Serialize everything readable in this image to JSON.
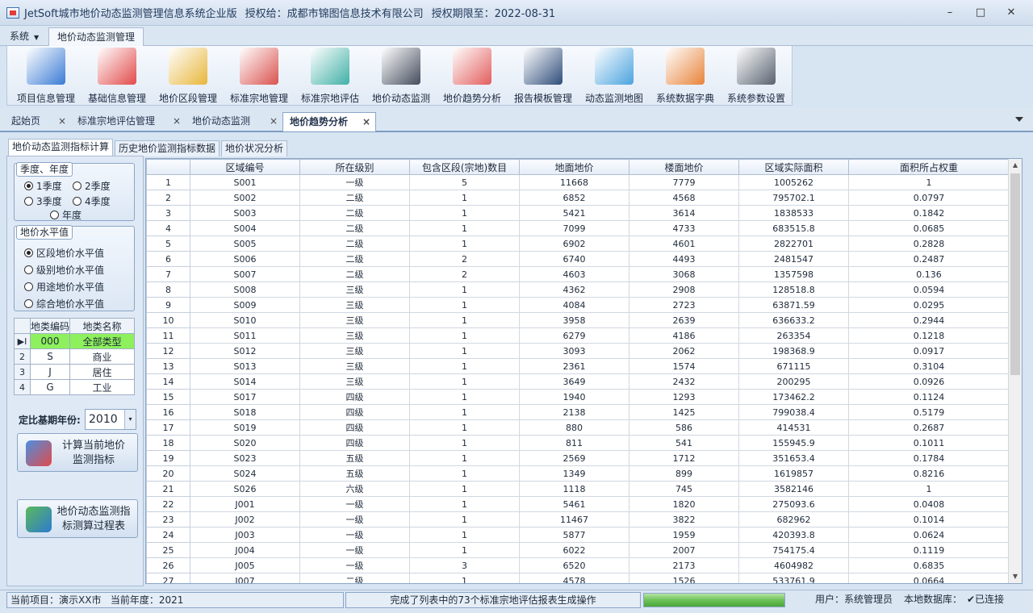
{
  "window": {
    "title_app": "JetSoft城市地价动态监测管理信息系统企业版",
    "title_license": "授权给：成都市锦图信息技术有限公司",
    "title_expiry": "授权期限至：2022-08-31",
    "minimize": "–",
    "maximize": "□",
    "close": "✕"
  },
  "menu": {
    "system": "系统",
    "ribbon_tab": "地价动态监测管理"
  },
  "ribbon": [
    {
      "label": "项目信息管理",
      "icon": "globe-computer-icon",
      "color": "#3a7bd5"
    },
    {
      "label": "基础信息管理",
      "icon": "clipboard-pencil-icon",
      "color": "#e24a4a"
    },
    {
      "label": "地价区段管理",
      "icon": "map-magnifier-icon",
      "color": "#e8b63a"
    },
    {
      "label": "标准宗地管理",
      "icon": "map-pin-icon",
      "color": "#d9534f"
    },
    {
      "label": "标准宗地评估",
      "icon": "house-dollar-icon",
      "color": "#40b0a6"
    },
    {
      "label": "地价动态监测",
      "icon": "monitor-chart-icon",
      "color": "#444c5c"
    },
    {
      "label": "地价趋势分析",
      "icon": "trend-report-icon",
      "color": "#e35d5d"
    },
    {
      "label": "报告模板管理",
      "icon": "laptop-gear-icon",
      "color": "#2f4d7a"
    },
    {
      "label": "动态监测地图",
      "icon": "map-search-icon",
      "color": "#4aa3df"
    },
    {
      "label": "系统数据字典",
      "icon": "bookshelf-icon",
      "color": "#e8833a"
    },
    {
      "label": "系统参数设置",
      "icon": "gears-icon",
      "color": "#596270"
    }
  ],
  "doc_tabs": [
    {
      "label": "起始页",
      "close": "×"
    },
    {
      "label": "标准宗地评估管理",
      "close": "×"
    },
    {
      "label": "地价动态监测",
      "close": "×"
    },
    {
      "label": "地价趋势分析",
      "close": "×"
    }
  ],
  "sub_tabs": [
    "地价动态监测指标计算",
    "历史地价监测指标数据",
    "地价状况分析"
  ],
  "left": {
    "season_group": "季度、年度",
    "q1": "1季度",
    "q2": "2季度",
    "q3": "3季度",
    "q4": "4季度",
    "year": "年度",
    "level_group": "地价水平值",
    "lv1": "区段地价水平值",
    "lv2": "级别地价水平值",
    "lv3": "用途地价水平值",
    "lv4": "综合地价水平值",
    "type_headers": [
      "地类编码",
      "地类名称"
    ],
    "types": [
      {
        "rh": "▶I",
        "code": "000",
        "name": "全部类型"
      },
      {
        "rh": "2",
        "code": "S",
        "name": "商业"
      },
      {
        "rh": "3",
        "code": "J",
        "name": "居住"
      },
      {
        "rh": "4",
        "code": "G",
        "name": "工业"
      }
    ],
    "base_year_label": "定比基期年份:",
    "base_year": "2010",
    "arrow": "▾",
    "calc_line1": "计算当前地价",
    "calc_line2": "监测指标",
    "proc_line1": "地价动态监测指",
    "proc_line2": "标测算过程表"
  },
  "grid": {
    "headers": [
      "区域编号",
      "所在级别",
      "包含区段(宗地)数目",
      "地面地价",
      "楼面地价",
      "区域实际面积",
      "面积所占权重"
    ],
    "rows": [
      [
        "1",
        "S001",
        "一级",
        "5",
        "11668",
        "7779",
        "1005262",
        "1"
      ],
      [
        "2",
        "S002",
        "二级",
        "1",
        "6852",
        "4568",
        "795702.1",
        "0.0797"
      ],
      [
        "3",
        "S003",
        "二级",
        "1",
        "5421",
        "3614",
        "1838533",
        "0.1842"
      ],
      [
        "4",
        "S004",
        "二级",
        "1",
        "7099",
        "4733",
        "683515.8",
        "0.0685"
      ],
      [
        "5",
        "S005",
        "二级",
        "1",
        "6902",
        "4601",
        "2822701",
        "0.2828"
      ],
      [
        "6",
        "S006",
        "二级",
        "2",
        "6740",
        "4493",
        "2481547",
        "0.2487"
      ],
      [
        "7",
        "S007",
        "二级",
        "2",
        "4603",
        "3068",
        "1357598",
        "0.136"
      ],
      [
        "8",
        "S008",
        "三级",
        "1",
        "4362",
        "2908",
        "128518.8",
        "0.0594"
      ],
      [
        "9",
        "S009",
        "三级",
        "1",
        "4084",
        "2723",
        "63871.59",
        "0.0295"
      ],
      [
        "10",
        "S010",
        "三级",
        "1",
        "3958",
        "2639",
        "636633.2",
        "0.2944"
      ],
      [
        "11",
        "S011",
        "三级",
        "1",
        "6279",
        "4186",
        "263354",
        "0.1218"
      ],
      [
        "12",
        "S012",
        "三级",
        "1",
        "3093",
        "2062",
        "198368.9",
        "0.0917"
      ],
      [
        "13",
        "S013",
        "三级",
        "1",
        "2361",
        "1574",
        "671115",
        "0.3104"
      ],
      [
        "14",
        "S014",
        "三级",
        "1",
        "3649",
        "2432",
        "200295",
        "0.0926"
      ],
      [
        "15",
        "S017",
        "四级",
        "1",
        "1940",
        "1293",
        "173462.2",
        "0.1124"
      ],
      [
        "16",
        "S018",
        "四级",
        "1",
        "2138",
        "1425",
        "799038.4",
        "0.5179"
      ],
      [
        "17",
        "S019",
        "四级",
        "1",
        "880",
        "586",
        "414531",
        "0.2687"
      ],
      [
        "18",
        "S020",
        "四级",
        "1",
        "811",
        "541",
        "155945.9",
        "0.1011"
      ],
      [
        "19",
        "S023",
        "五级",
        "1",
        "2569",
        "1712",
        "351653.4",
        "0.1784"
      ],
      [
        "20",
        "S024",
        "五级",
        "1",
        "1349",
        "899",
        "1619857",
        "0.8216"
      ],
      [
        "21",
        "S026",
        "六级",
        "1",
        "1118",
        "745",
        "3582146",
        "1"
      ],
      [
        "22",
        "J001",
        "一级",
        "1",
        "5461",
        "1820",
        "275093.6",
        "0.0408"
      ],
      [
        "23",
        "J002",
        "一级",
        "1",
        "11467",
        "3822",
        "682962",
        "0.1014"
      ],
      [
        "24",
        "J003",
        "一级",
        "1",
        "5877",
        "1959",
        "420393.8",
        "0.0624"
      ],
      [
        "25",
        "J004",
        "一级",
        "1",
        "6022",
        "2007",
        "754175.4",
        "0.1119"
      ],
      [
        "26",
        "J005",
        "一级",
        "3",
        "6520",
        "2173",
        "4604982",
        "0.6835"
      ],
      [
        "27",
        "J007",
        "二级",
        "1",
        "4578",
        "1526",
        "533761.9",
        "0.0664"
      ]
    ],
    "scroll_up": "▲",
    "scroll_down": "▼"
  },
  "status": {
    "project": "当前项目：演示XX市",
    "year": "当前年度：2021",
    "message": "完成了列表中的73个标准宗地评估报表生成操作",
    "progress": 1.0,
    "user": "用户：系统管理员",
    "db": "本地数据库：",
    "connected": "✔已连接"
  }
}
